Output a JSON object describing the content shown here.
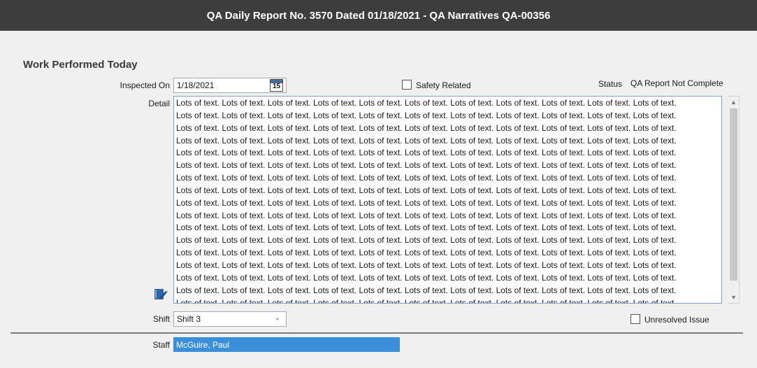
{
  "window": {
    "title": "QA Daily Report No. 3570 Dated 01/18/2021 - QA Narratives QA-00356"
  },
  "section": {
    "title": "Work Performed Today"
  },
  "fields": {
    "inspected_on_label": "Inspected On",
    "inspected_on_value": "1/18/2021",
    "calendar_day": "15",
    "safety_related_label": "Safety Related",
    "status_label": "Status",
    "status_value": "QA Report Not Complete",
    "detail_label": "Detail",
    "detail_value": "Lots of text. Lots of text. Lots of text. Lots of text. Lots of text. Lots of text. Lots of text. Lots of text. Lots of text. Lots of text. Lots of text.\nLots of text. Lots of text. Lots of text. Lots of text. Lots of text. Lots of text. Lots of text. Lots of text. Lots of text. Lots of text. Lots of text.\nLots of text. Lots of text. Lots of text. Lots of text. Lots of text. Lots of text. Lots of text. Lots of text. Lots of text. Lots of text. Lots of text.\nLots of text. Lots of text. Lots of text. Lots of text. Lots of text. Lots of text. Lots of text. Lots of text. Lots of text. Lots of text. Lots of text.\nLots of text. Lots of text. Lots of text. Lots of text. Lots of text. Lots of text. Lots of text. Lots of text. Lots of text. Lots of text. Lots of text.\nLots of text. Lots of text. Lots of text. Lots of text. Lots of text. Lots of text. Lots of text. Lots of text. Lots of text. Lots of text. Lots of text.\nLots of text. Lots of text. Lots of text. Lots of text. Lots of text. Lots of text. Lots of text. Lots of text. Lots of text. Lots of text. Lots of text.\nLots of text. Lots of text. Lots of text. Lots of text. Lots of text. Lots of text. Lots of text. Lots of text. Lots of text. Lots of text. Lots of text.\nLots of text. Lots of text. Lots of text. Lots of text. Lots of text. Lots of text. Lots of text. Lots of text. Lots of text. Lots of text. Lots of text.\nLots of text. Lots of text. Lots of text. Lots of text. Lots of text. Lots of text. Lots of text. Lots of text. Lots of text. Lots of text. Lots of text.\nLots of text. Lots of text. Lots of text. Lots of text. Lots of text. Lots of text. Lots of text. Lots of text. Lots of text. Lots of text. Lots of text.\nLots of text. Lots of text. Lots of text. Lots of text. Lots of text. Lots of text. Lots of text. Lots of text. Lots of text. Lots of text. Lots of text.\nLots of text. Lots of text. Lots of text. Lots of text. Lots of text. Lots of text. Lots of text. Lots of text. Lots of text. Lots of text. Lots of text.\nLots of text. Lots of text. Lots of text. Lots of text. Lots of text. Lots of text. Lots of text. Lots of text. Lots of text. Lots of text. Lots of text.\nLots of text. Lots of text. Lots of text. Lots of text. Lots of text. Lots of text. Lots of text. Lots of text. Lots of text. Lots of text. Lots of text.\nLots of text. Lots of text. Lots of text. Lots of text. Lots of text. Lots of text. Lots of text. Lots of text. Lots of text. Lots of text. Lots of text.\nLots of text. Lots of text. Lots of text. Lots of text. Lots of text. Lots of text. Lots of text. Lots of text. Lots of text. Lots of text. Lots of text.",
    "shift_label": "Shift",
    "shift_value": "Shift 3",
    "unresolved_issue_label": "Unresolved Issue",
    "staff_label": "Staff",
    "staff_value": "McGuire, Paul"
  },
  "icons": {
    "calendar": "calendar-icon",
    "notes": "notes-edit-icon",
    "scroll_up": "chevron-up-icon",
    "scroll_down": "chevron-down-icon",
    "dropdown": "chevron-down-icon"
  },
  "colors": {
    "titlebar_bg": "#3d3d3d",
    "selection_bg": "#3b8fd9",
    "focus_border": "#7aa3d4"
  }
}
